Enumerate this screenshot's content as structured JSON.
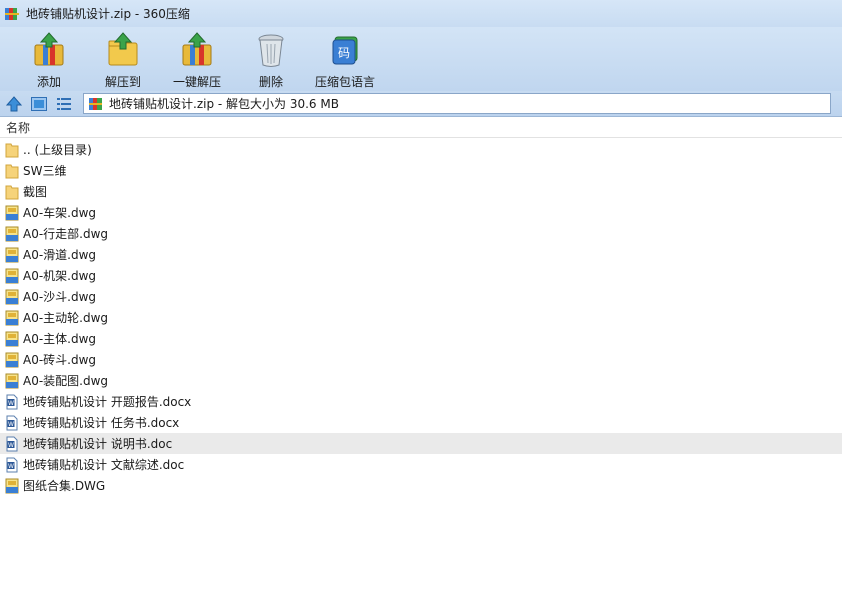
{
  "window": {
    "title": "地砖铺贴机设计.zip - 360压缩"
  },
  "toolbar": {
    "items": [
      {
        "label": "添加",
        "icon": "add-archive-icon"
      },
      {
        "label": "解压到",
        "icon": "extract-to-icon"
      },
      {
        "label": "一键解压",
        "icon": "one-click-extract-icon"
      },
      {
        "label": "删除",
        "icon": "delete-trash-icon"
      },
      {
        "label": "压缩包语言",
        "icon": "archive-language-icon"
      }
    ],
    "language_glyph": "码"
  },
  "address": {
    "path": "地砖铺贴机设计.zip - 解包大小为 30.6 MB"
  },
  "columns": {
    "name": "名称"
  },
  "files": [
    {
      "name": ".. (上级目录)",
      "type": "folder"
    },
    {
      "name": "SW三维",
      "type": "folder"
    },
    {
      "name": "截图",
      "type": "folder"
    },
    {
      "name": "A0-车架.dwg",
      "type": "dwg"
    },
    {
      "name": "A0-行走部.dwg",
      "type": "dwg"
    },
    {
      "name": "A0-滑道.dwg",
      "type": "dwg"
    },
    {
      "name": "A0-机架.dwg",
      "type": "dwg"
    },
    {
      "name": "A0-沙斗.dwg",
      "type": "dwg"
    },
    {
      "name": "A0-主动轮.dwg",
      "type": "dwg"
    },
    {
      "name": "A0-主体.dwg",
      "type": "dwg"
    },
    {
      "name": "A0-砖斗.dwg",
      "type": "dwg"
    },
    {
      "name": "A0-装配图.dwg",
      "type": "dwg"
    },
    {
      "name": "地砖铺贴机设计 开题报告.docx",
      "type": "doc"
    },
    {
      "name": "地砖铺贴机设计 任务书.docx",
      "type": "doc"
    },
    {
      "name": "地砖铺贴机设计 说明书.doc",
      "type": "doc",
      "selected": true
    },
    {
      "name": "地砖铺贴机设计 文献综述.doc",
      "type": "doc"
    },
    {
      "name": "图纸合集.DWG",
      "type": "dwg"
    }
  ]
}
